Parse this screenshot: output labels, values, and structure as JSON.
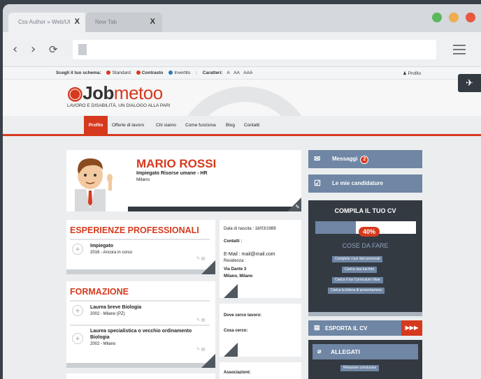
{
  "browser": {
    "tabs": [
      {
        "label": "Css Author » Web/UI",
        "close": "X"
      },
      {
        "label": "New Tab",
        "close": "X"
      }
    ],
    "nav": {
      "back": "‹",
      "forward": "›",
      "reload": "⟳"
    },
    "window_dots": [
      "#5cb85c",
      "#f0ad4e",
      "#e8573f"
    ]
  },
  "toolbar": {
    "scheme_label": "Scegli il tuo schema:",
    "schemes": [
      {
        "label": "Standard",
        "color": "#d63a1e"
      },
      {
        "label": "Contrasto",
        "color": "#d63a1e"
      },
      {
        "label": "Invertito",
        "color": "#2b7bb9"
      }
    ],
    "chars_label": "Caratteri:",
    "chars": [
      "A",
      "AA",
      "AAA"
    ],
    "profile_link": "Profilo"
  },
  "header": {
    "logo_prefix": "",
    "logo_job": "Job",
    "logo_metoo": "metoo",
    "tagline": "LAVORO E DISABILITÀ, UN DIALOGO ALLA PARI"
  },
  "nav": {
    "active": "Profilo",
    "items": [
      "Offerte di lavoro",
      "Chi siamo",
      "Come funziona",
      "Blog",
      "Contatti"
    ]
  },
  "profile": {
    "name": "MARIO ROSSI",
    "role": "Impiegato Risorse umane - HR",
    "city": "Milano"
  },
  "experience": {
    "title": "ESPERIENZE PROFESSIONALI",
    "items": [
      {
        "title": "Impiegato",
        "sub": "2016 - Ancora in corso"
      }
    ]
  },
  "education": {
    "title": "FORMAZIONE",
    "items": [
      {
        "title": "Laurea breve Biologia",
        "sub": "2002 - Milano (PZ)"
      },
      {
        "title": "Laurea specialistica o vecchio ordinamento",
        "title2": "Biologia",
        "sub": "2002 - Milano"
      }
    ]
  },
  "personal": {
    "birth": "Data di nascita : 18/03/1989",
    "contacts": "Contatti :",
    "email": "E-Mail : mail@mail.com",
    "residence": "Residenza :",
    "address1": "Via Dante 3",
    "address2": "Milano, Milano"
  },
  "search": {
    "where": "Dove cerco lavoro:",
    "what": "Cosa cerco:",
    "assoc": "Associazioni:"
  },
  "sidebar": {
    "messages": "Messaggi",
    "messages_count": "2",
    "applications": "Le mie candidature",
    "cv_title": "COMPILA IL TUO CV",
    "progress": 0.4,
    "progress_label": "40%",
    "todo_title": "COSE DA FARE",
    "todo": [
      "Completa i tuoi dati personali",
      "Carica una tua foto",
      "Carica il tuo Curriculum Vitae",
      "Carica la lettera di presentazione"
    ],
    "export": "ESPORTA IL CV",
    "export_arrow": "▶▶▶",
    "attachments": "ALLEGATI",
    "attachment_items": [
      "Relazione conclusiva"
    ]
  }
}
